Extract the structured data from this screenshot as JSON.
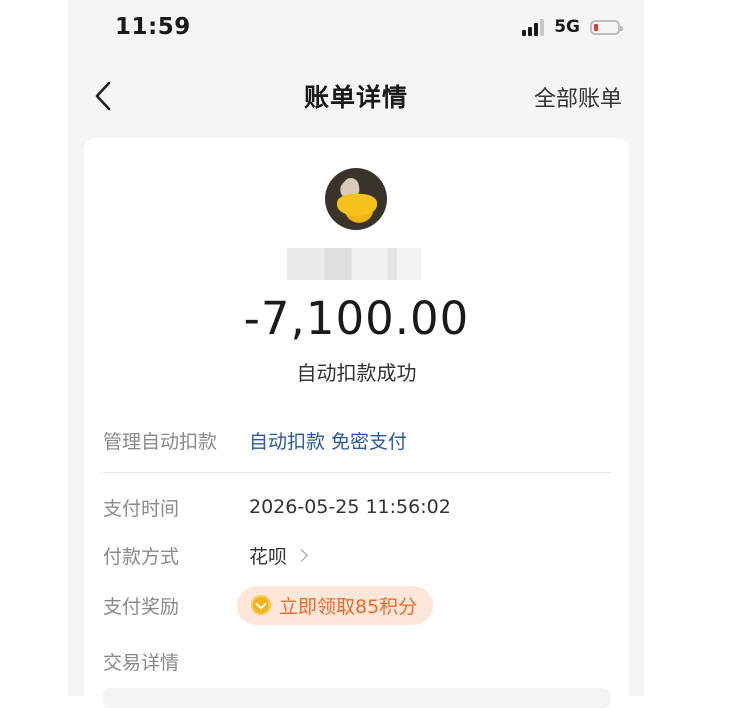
{
  "status_bar": {
    "time": "11:59",
    "network": "5G"
  },
  "nav": {
    "title": "账单详情",
    "right_label": "全部账单"
  },
  "bill": {
    "amount": "-7,100.00",
    "status": "自动扣款成功",
    "manage_label": "管理自动扣款",
    "manage_links": [
      "自动扣款",
      "免密支付"
    ],
    "pay_time_label": "支付时间",
    "pay_time": "2026-05-25 11:56:02",
    "pay_method_label": "付款方式",
    "pay_method": "花呗",
    "reward_label": "支付奖励",
    "reward_text": "立即领取85积分",
    "detail_label": "交易详情"
  },
  "colors": {
    "link": "#2b5a9c",
    "reward_bg": "#fde7da",
    "reward_text": "#ea6b29",
    "battery_low": "#e53935"
  }
}
